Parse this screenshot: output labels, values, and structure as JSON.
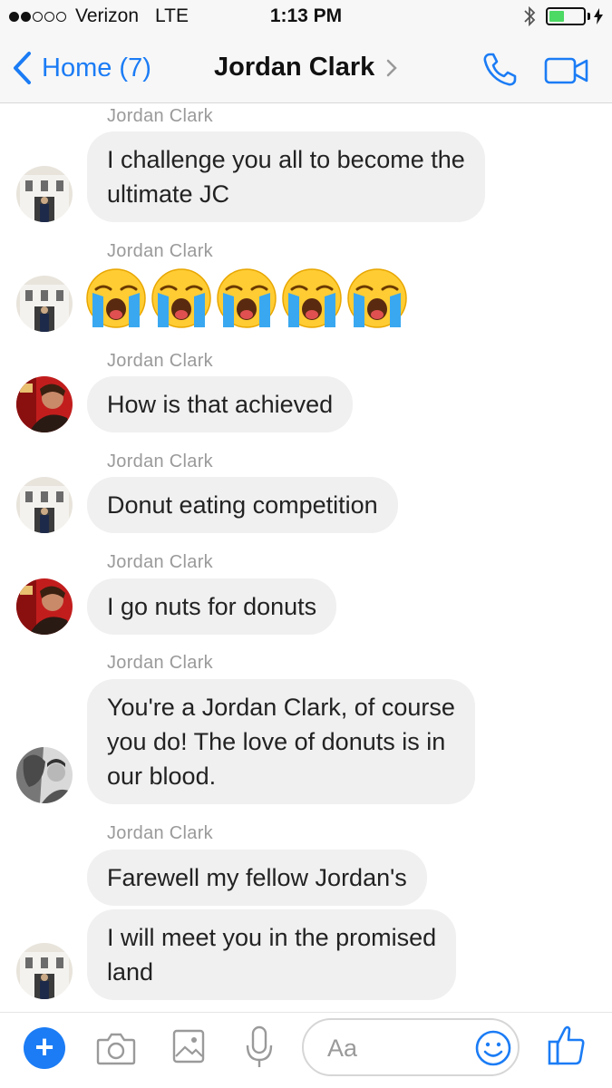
{
  "status_bar": {
    "carrier": "Verizon",
    "network": "LTE",
    "time": "1:13 PM"
  },
  "nav": {
    "back_label": "Home (7)",
    "title": "Jordan Clark"
  },
  "messages": [
    {
      "sender": "Jordan Clark",
      "lines": [
        "I challenge you all to become the",
        "ultimate JC"
      ],
      "avatar": "avatar-building"
    },
    {
      "sender": "Jordan Clark",
      "emoji": "loudly-crying-face",
      "emoji_count": 5,
      "avatar": "avatar-building"
    },
    {
      "sender": "Jordan Clark",
      "lines": [
        "How is that achieved"
      ],
      "avatar": "avatar-red"
    },
    {
      "sender": "Jordan Clark",
      "lines": [
        "Donut eating competition"
      ],
      "avatar": "avatar-building"
    },
    {
      "sender": "Jordan Clark",
      "lines": [
        "I go nuts for donuts"
      ],
      "avatar": "avatar-red"
    },
    {
      "sender": "Jordan Clark",
      "lines": [
        "You're a Jordan Clark, of course",
        "you do!  The love of donuts is in",
        "our blood."
      ],
      "avatar": "avatar-bw"
    },
    {
      "sender": "Jordan Clark",
      "lines": [
        "Farewell my fellow Jordan's"
      ]
    },
    {
      "lines": [
        "I will meet you in the promised",
        "land"
      ],
      "avatar": "avatar-building"
    }
  ],
  "composer": {
    "placeholder": "Aa",
    "plus_label": "+"
  },
  "colors": {
    "accent": "#1b7cf5",
    "bubble": "#f0f0f0",
    "sender_text": "#9a9a9a",
    "battery": "#4cd964"
  },
  "battery_level": 0.45
}
